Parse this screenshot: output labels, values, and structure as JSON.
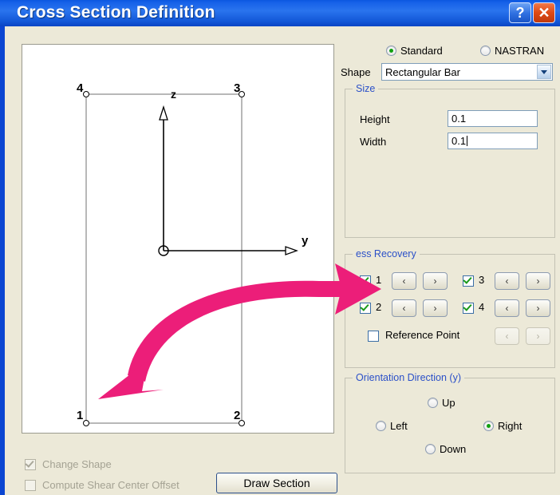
{
  "window": {
    "title": "Cross Section Definition",
    "help_button": "?",
    "close_button": "✕"
  },
  "type_options": [
    {
      "label": "Standard",
      "selected": true
    },
    {
      "label": "NASTRAN",
      "selected": false
    }
  ],
  "shape": {
    "label": "Shape",
    "value": "Rectangular Bar",
    "dropdown_icon": "chevron-down-icon"
  },
  "size_group": {
    "legend": "Size",
    "fields": [
      {
        "label": "Height",
        "value": "0.1",
        "focused": false
      },
      {
        "label": "Width",
        "value": "0.1",
        "focused": true
      }
    ]
  },
  "stress_recovery": {
    "legend": "Stress Recovery",
    "legend_visible": "ess Recovery",
    "points": [
      {
        "number": "1",
        "checked": true,
        "prev": "‹",
        "next": "›"
      },
      {
        "number": "3",
        "checked": true,
        "prev": "‹",
        "next": "›"
      },
      {
        "number": "2",
        "checked": true,
        "prev": "‹",
        "next": "›"
      },
      {
        "number": "4",
        "checked": true,
        "prev": "‹",
        "next": "›"
      }
    ],
    "reference_point": {
      "label": "Reference Point",
      "checked": false,
      "prev": "‹",
      "next": "›",
      "enabled": false
    }
  },
  "orientation": {
    "legend": "Orientation Direction (y)",
    "options": [
      {
        "label": "Up",
        "selected": false
      },
      {
        "label": "Left",
        "selected": false
      },
      {
        "label": "Right",
        "selected": true
      },
      {
        "label": "Down",
        "selected": false
      }
    ]
  },
  "bottom": {
    "change_shape": {
      "label": "Change Shape",
      "checked": true,
      "enabled": false
    },
    "compute_shear": {
      "label": "Compute Shear Center Offset",
      "checked": false,
      "enabled": false
    },
    "draw_button": "Draw Section"
  },
  "canvas": {
    "corner_labels": {
      "node4": "4",
      "node3": "3",
      "node1": "1",
      "node2": "2"
    },
    "axis_labels": {
      "vertical": "z",
      "horizontal": "y"
    }
  },
  "colors": {
    "titlebar_blue": "#1560e8",
    "dialog_bg": "#ece9d8",
    "group_legend": "#2b50c8",
    "check_green": "#1a9a1a",
    "radio_green": "#11a011",
    "annotation_pink": "#ec1e79",
    "close_red": "#de4a16"
  }
}
